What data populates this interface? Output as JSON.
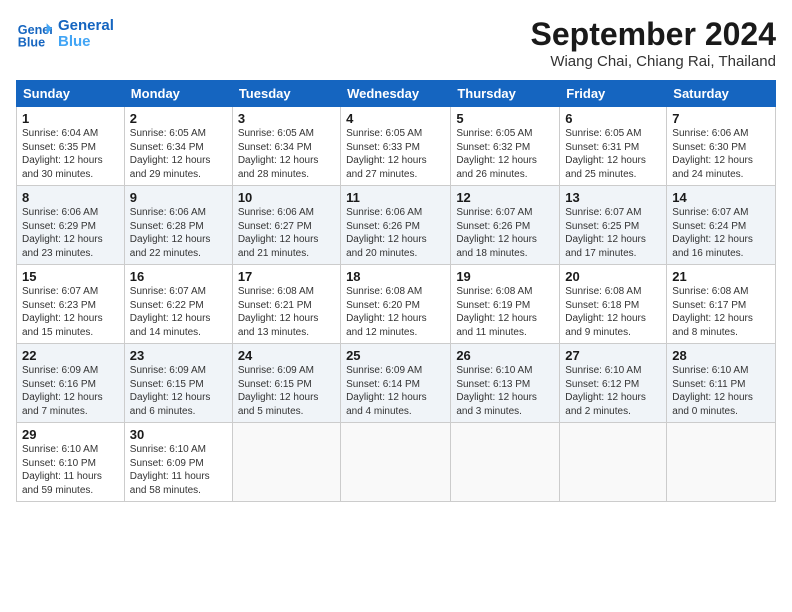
{
  "header": {
    "logo_line1": "General",
    "logo_line2": "Blue",
    "month_year": "September 2024",
    "location": "Wiang Chai, Chiang Rai, Thailand"
  },
  "days_of_week": [
    "Sunday",
    "Monday",
    "Tuesday",
    "Wednesday",
    "Thursday",
    "Friday",
    "Saturday"
  ],
  "weeks": [
    [
      {
        "day": 1,
        "info": "Sunrise: 6:04 AM\nSunset: 6:35 PM\nDaylight: 12 hours\nand 30 minutes."
      },
      {
        "day": 2,
        "info": "Sunrise: 6:05 AM\nSunset: 6:34 PM\nDaylight: 12 hours\nand 29 minutes."
      },
      {
        "day": 3,
        "info": "Sunrise: 6:05 AM\nSunset: 6:34 PM\nDaylight: 12 hours\nand 28 minutes."
      },
      {
        "day": 4,
        "info": "Sunrise: 6:05 AM\nSunset: 6:33 PM\nDaylight: 12 hours\nand 27 minutes."
      },
      {
        "day": 5,
        "info": "Sunrise: 6:05 AM\nSunset: 6:32 PM\nDaylight: 12 hours\nand 26 minutes."
      },
      {
        "day": 6,
        "info": "Sunrise: 6:05 AM\nSunset: 6:31 PM\nDaylight: 12 hours\nand 25 minutes."
      },
      {
        "day": 7,
        "info": "Sunrise: 6:06 AM\nSunset: 6:30 PM\nDaylight: 12 hours\nand 24 minutes."
      }
    ],
    [
      {
        "day": 8,
        "info": "Sunrise: 6:06 AM\nSunset: 6:29 PM\nDaylight: 12 hours\nand 23 minutes."
      },
      {
        "day": 9,
        "info": "Sunrise: 6:06 AM\nSunset: 6:28 PM\nDaylight: 12 hours\nand 22 minutes."
      },
      {
        "day": 10,
        "info": "Sunrise: 6:06 AM\nSunset: 6:27 PM\nDaylight: 12 hours\nand 21 minutes."
      },
      {
        "day": 11,
        "info": "Sunrise: 6:06 AM\nSunset: 6:26 PM\nDaylight: 12 hours\nand 20 minutes."
      },
      {
        "day": 12,
        "info": "Sunrise: 6:07 AM\nSunset: 6:26 PM\nDaylight: 12 hours\nand 18 minutes."
      },
      {
        "day": 13,
        "info": "Sunrise: 6:07 AM\nSunset: 6:25 PM\nDaylight: 12 hours\nand 17 minutes."
      },
      {
        "day": 14,
        "info": "Sunrise: 6:07 AM\nSunset: 6:24 PM\nDaylight: 12 hours\nand 16 minutes."
      }
    ],
    [
      {
        "day": 15,
        "info": "Sunrise: 6:07 AM\nSunset: 6:23 PM\nDaylight: 12 hours\nand 15 minutes."
      },
      {
        "day": 16,
        "info": "Sunrise: 6:07 AM\nSunset: 6:22 PM\nDaylight: 12 hours\nand 14 minutes."
      },
      {
        "day": 17,
        "info": "Sunrise: 6:08 AM\nSunset: 6:21 PM\nDaylight: 12 hours\nand 13 minutes."
      },
      {
        "day": 18,
        "info": "Sunrise: 6:08 AM\nSunset: 6:20 PM\nDaylight: 12 hours\nand 12 minutes."
      },
      {
        "day": 19,
        "info": "Sunrise: 6:08 AM\nSunset: 6:19 PM\nDaylight: 12 hours\nand 11 minutes."
      },
      {
        "day": 20,
        "info": "Sunrise: 6:08 AM\nSunset: 6:18 PM\nDaylight: 12 hours\nand 9 minutes."
      },
      {
        "day": 21,
        "info": "Sunrise: 6:08 AM\nSunset: 6:17 PM\nDaylight: 12 hours\nand 8 minutes."
      }
    ],
    [
      {
        "day": 22,
        "info": "Sunrise: 6:09 AM\nSunset: 6:16 PM\nDaylight: 12 hours\nand 7 minutes."
      },
      {
        "day": 23,
        "info": "Sunrise: 6:09 AM\nSunset: 6:15 PM\nDaylight: 12 hours\nand 6 minutes."
      },
      {
        "day": 24,
        "info": "Sunrise: 6:09 AM\nSunset: 6:15 PM\nDaylight: 12 hours\nand 5 minutes."
      },
      {
        "day": 25,
        "info": "Sunrise: 6:09 AM\nSunset: 6:14 PM\nDaylight: 12 hours\nand 4 minutes."
      },
      {
        "day": 26,
        "info": "Sunrise: 6:10 AM\nSunset: 6:13 PM\nDaylight: 12 hours\nand 3 minutes."
      },
      {
        "day": 27,
        "info": "Sunrise: 6:10 AM\nSunset: 6:12 PM\nDaylight: 12 hours\nand 2 minutes."
      },
      {
        "day": 28,
        "info": "Sunrise: 6:10 AM\nSunset: 6:11 PM\nDaylight: 12 hours\nand 0 minutes."
      }
    ],
    [
      {
        "day": 29,
        "info": "Sunrise: 6:10 AM\nSunset: 6:10 PM\nDaylight: 11 hours\nand 59 minutes."
      },
      {
        "day": 30,
        "info": "Sunrise: 6:10 AM\nSunset: 6:09 PM\nDaylight: 11 hours\nand 58 minutes."
      },
      null,
      null,
      null,
      null,
      null
    ]
  ]
}
